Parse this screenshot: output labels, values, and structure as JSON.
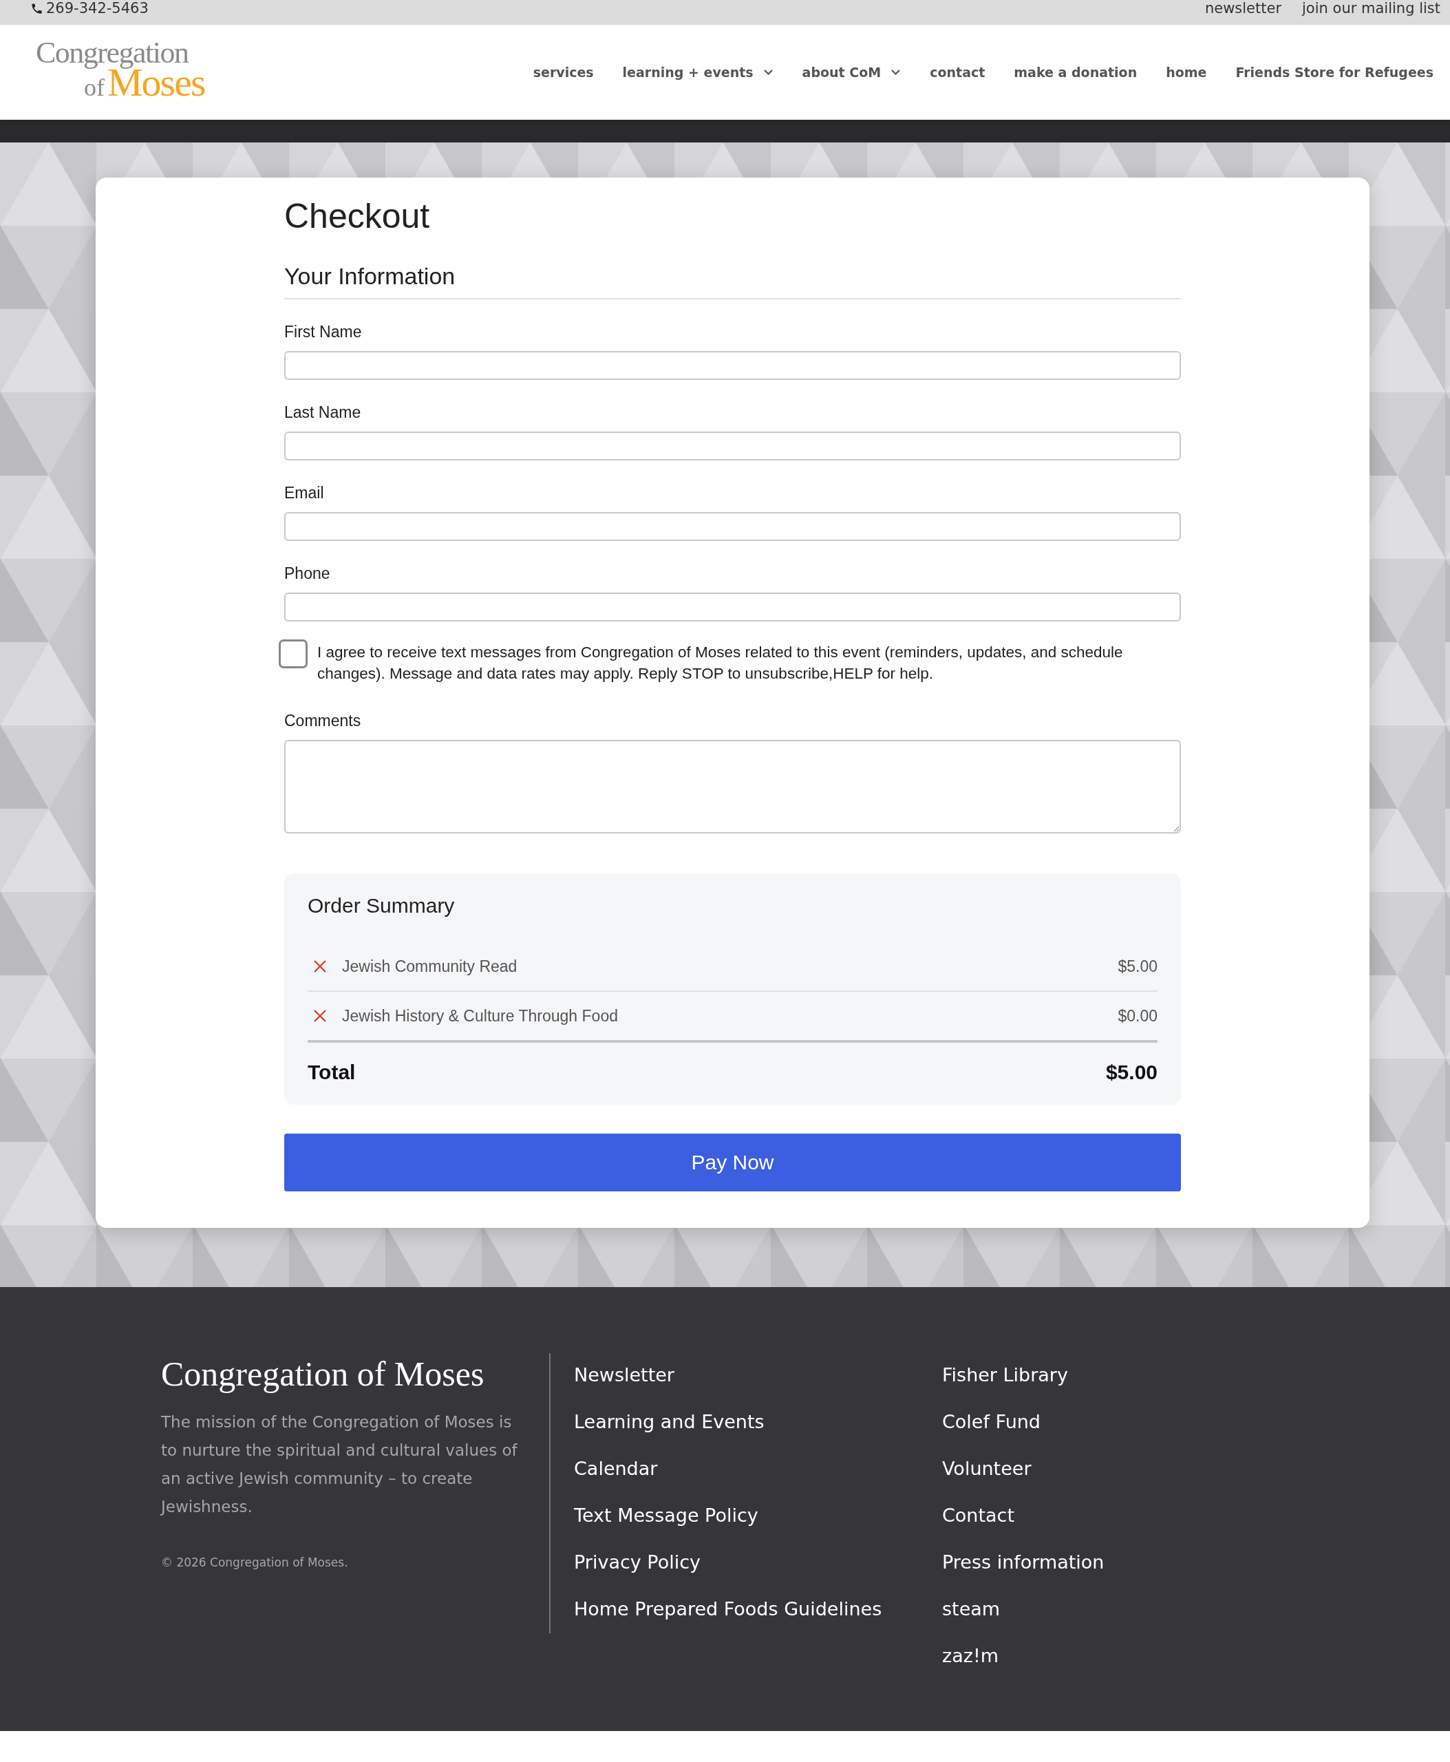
{
  "top_bar": {
    "phone": "269-342-5463",
    "links": [
      "newsletter",
      "join our mailing list"
    ]
  },
  "header": {
    "logo": {
      "line_1": "Congregation",
      "line_2_small": "of",
      "line_2_large": "Moses"
    },
    "nav": [
      {
        "label": "services",
        "kind": "link"
      },
      {
        "label": "learning + events",
        "kind": "dropdown"
      },
      {
        "label": "about CoM",
        "kind": "dropdown"
      },
      {
        "label": "contact",
        "kind": "link"
      },
      {
        "label": "make a donation",
        "kind": "link"
      },
      {
        "label": "home",
        "kind": "link"
      },
      {
        "label": "Friends Store for Refugees",
        "kind": "link"
      }
    ]
  },
  "checkout": {
    "title": "Checkout",
    "section_title": "Your Information",
    "fields": [
      {
        "label": "First Name",
        "kind": "input"
      },
      {
        "label": "Last Name",
        "kind": "input"
      },
      {
        "label": "Email",
        "kind": "input"
      },
      {
        "label": "Phone",
        "kind": "input"
      }
    ],
    "consent": {
      "text": "I agree to receive text messages from Congregation of Moses related to this event (reminders, updates, and schedule changes). Message and data rates may apply. Reply STOP to unsubscribe,HELP for help.",
      "checked": false
    },
    "comments": {
      "label": "Comments"
    },
    "order_summary": {
      "title": "Order Summary",
      "items": [
        {
          "name": "Jewish Community Read",
          "price": "$5.00"
        },
        {
          "name": "Jewish History & Culture Through Food",
          "price": "$0.00"
        }
      ],
      "total_label": "Total",
      "total": "$5.00"
    },
    "pay_button": "Pay Now"
  },
  "footer": {
    "title": "Congregation of Moses",
    "mission": "The mission of the Congregation of Moses is to nurture the spiritual and cultural values of an active Jewish community – to create Jewishness.",
    "copyright": "© 2026 Congregation of Moses.",
    "links_column_1": [
      "Newsletter",
      "Learning and Events",
      "Calendar",
      "Text Message Policy",
      "Privacy Policy",
      "Home Prepared Foods Guidelines"
    ],
    "links_column_2": [
      "Fisher Library",
      "Colef Fund",
      "Volunteer",
      "Contact",
      "Press information",
      "steam",
      "zaz!m"
    ]
  }
}
